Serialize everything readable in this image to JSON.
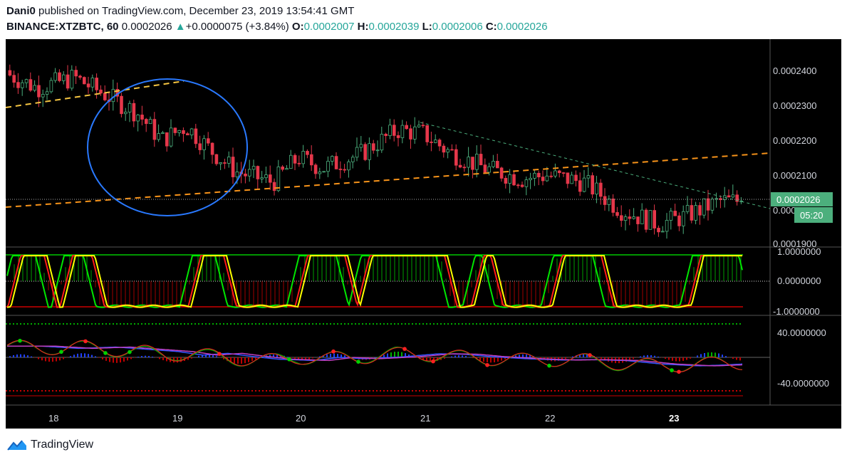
{
  "header": {
    "author": "Dani0",
    "published_text": "published on TradingView.com, December 23, 2019 13:54:41 GMT",
    "symbol": "BINANCE:XTZBTC, 60",
    "last_price": "0.0002026",
    "change_arrow": "▲",
    "change": "+0.0000075 (+3.84%)",
    "open_label": "O:",
    "open": "0.0002007",
    "high_label": "H:",
    "high": "0.0002039",
    "low_label": "L:",
    "low": "0.0002006",
    "close_label": "C:",
    "close": "0.0002026"
  },
  "colors": {
    "up": "#26a69a",
    "bull_candle": "#4caf7d",
    "bear_candle": "#e5374a",
    "trend_orange": "#f7931a",
    "trend_yellow": "#f5c542",
    "circle": "#2979ff",
    "osc_green": "#00e600",
    "osc_red": "#ff1a1a",
    "osc_yellow": "#ffff00",
    "price_tag": "#4caf7d"
  },
  "price_axis": {
    "ticks": [
      "0.0002400",
      "0.0002300",
      "0.0002200",
      "0.0002100",
      "0.000",
      "0.0001900"
    ],
    "last_price_tag": "0.0002026",
    "countdown_tag": "05:20"
  },
  "osc1_axis": {
    "ticks": [
      "1.0000000",
      "0.0000000",
      "-1.0000000"
    ]
  },
  "osc2_axis": {
    "ticks": [
      "40.0000000",
      "-40.0000000"
    ]
  },
  "time_axis": {
    "ticks": [
      "18",
      "19",
      "20",
      "21",
      "22",
      "23"
    ]
  },
  "chart_data": {
    "type": "candlestick",
    "symbol": "BINANCE:XTZBTC",
    "interval": "60",
    "x": [
      "18",
      "19",
      "20",
      "21",
      "22",
      "23"
    ],
    "ylim": [
      0.000187,
      0.000247
    ],
    "ohlc_last": {
      "open": 0.0002007,
      "high": 0.0002039,
      "low": 0.0002006,
      "close": 0.0002026
    },
    "close_points": [
      [
        17.6,
        0.00024
      ],
      [
        17.9,
        0.000235
      ],
      [
        18.2,
        0.000238
      ],
      [
        18.5,
        0.000232
      ],
      [
        18.7,
        0.000228
      ],
      [
        18.9,
        0.00022
      ],
      [
        19.1,
        0.000224
      ],
      [
        19.3,
        0.000217
      ],
      [
        19.5,
        0.000211
      ],
      [
        19.8,
        0.000208
      ],
      [
        20.0,
        0.000215
      ],
      [
        20.2,
        0.000212
      ],
      [
        20.5,
        0.000216
      ],
      [
        20.8,
        0.000223
      ],
      [
        21.0,
        0.000222
      ],
      [
        21.2,
        0.000217
      ],
      [
        21.5,
        0.000212
      ],
      [
        21.8,
        0.000209
      ],
      [
        22.0,
        0.00021
      ],
      [
        22.3,
        0.000208
      ],
      [
        22.6,
        0.0002
      ],
      [
        22.9,
        0.000196
      ],
      [
        23.1,
        0.000198
      ],
      [
        23.4,
        0.0002026
      ]
    ],
    "indicator1_range": [
      -1,
      1
    ],
    "indicator2_range": [
      -50,
      50
    ]
  },
  "brand": {
    "name": "TradingView"
  }
}
